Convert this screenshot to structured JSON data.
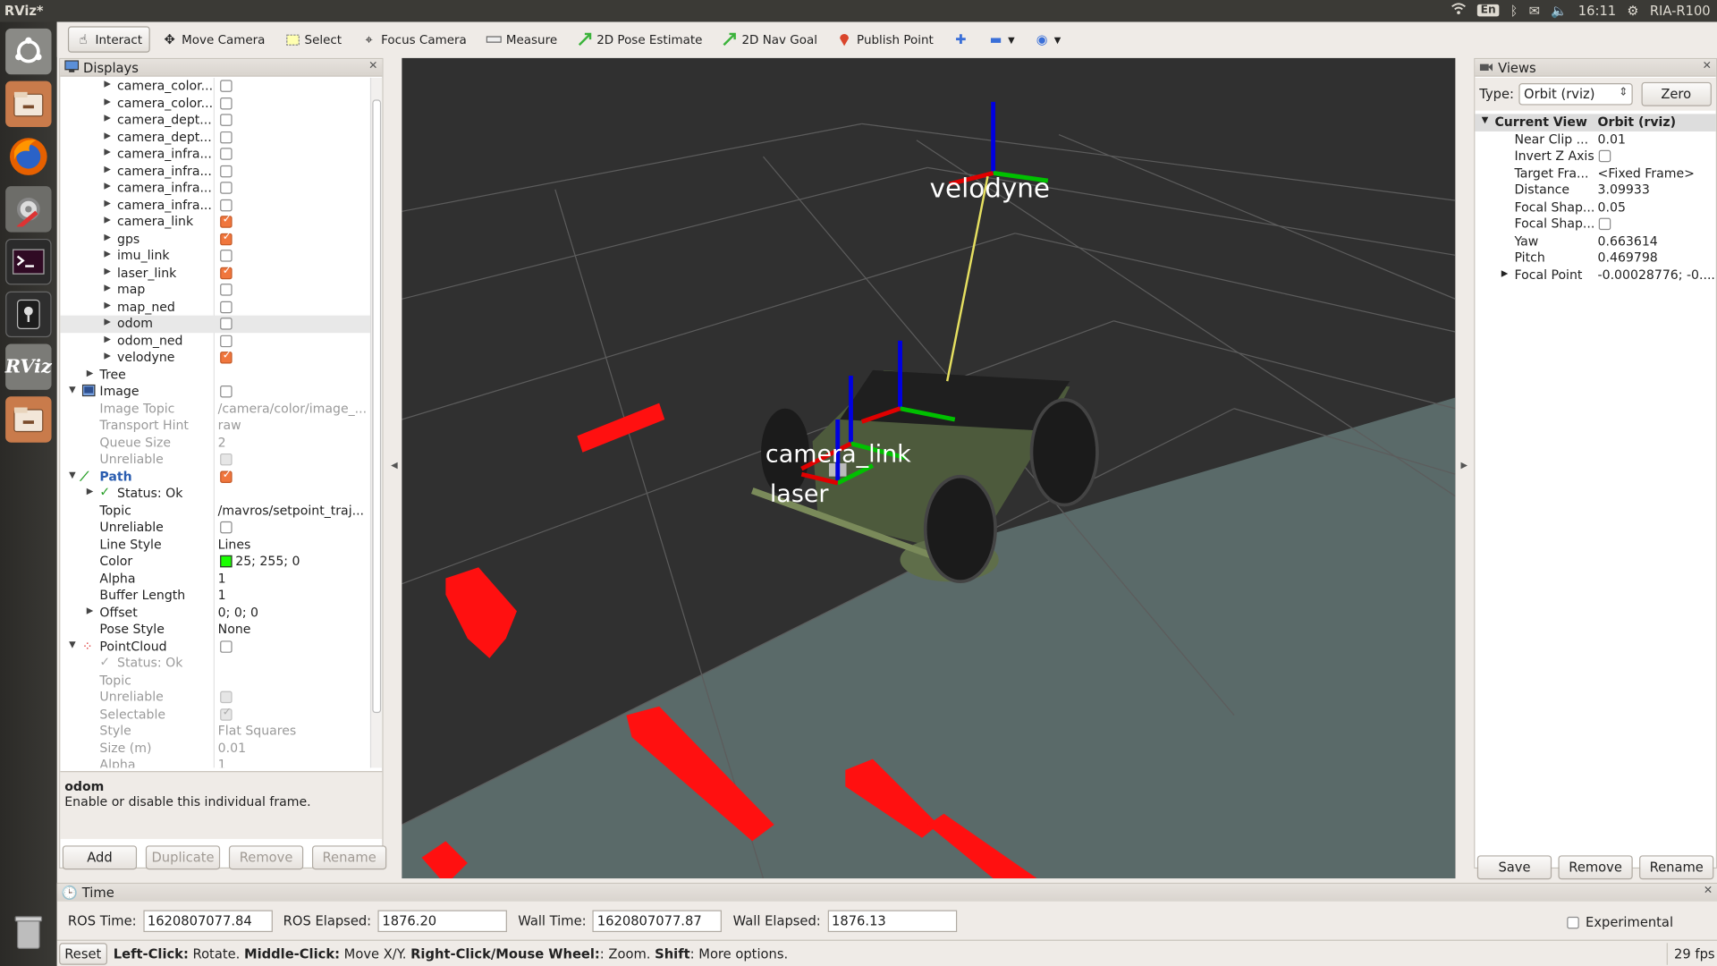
{
  "topbar": {
    "title": "RViz*",
    "lang": "En",
    "clock": "16:11",
    "host": "RIA-R100"
  },
  "toolbar": {
    "tools": [
      "Interact",
      "Move Camera",
      "Select",
      "Focus Camera",
      "Measure",
      "2D Pose Estimate",
      "2D Nav Goal",
      "Publish Point"
    ]
  },
  "displays": {
    "title": "Displays",
    "rows": [
      {
        "name": "camera_color...",
        "checked": false
      },
      {
        "name": "camera_color...",
        "checked": false
      },
      {
        "name": "camera_dept...",
        "checked": false
      },
      {
        "name": "camera_dept...",
        "checked": false
      },
      {
        "name": "camera_infra...",
        "checked": false
      },
      {
        "name": "camera_infra...",
        "checked": false
      },
      {
        "name": "camera_infra...",
        "checked": false
      },
      {
        "name": "camera_infra...",
        "checked": false
      },
      {
        "name": "camera_link",
        "checked": true
      },
      {
        "name": "gps",
        "checked": true
      },
      {
        "name": "imu_link",
        "checked": false
      },
      {
        "name": "laser_link",
        "checked": true
      },
      {
        "name": "map",
        "checked": false
      },
      {
        "name": "map_ned",
        "checked": false
      },
      {
        "name": "odom",
        "checked": false
      },
      {
        "name": "odom_ned",
        "checked": false
      },
      {
        "name": "velodyne",
        "checked": true
      }
    ],
    "tree_label": "Tree",
    "image": {
      "label": "Image",
      "props": [
        {
          "k": "Image Topic",
          "v": "/camera/color/image_..."
        },
        {
          "k": "Transport Hint",
          "v": "raw"
        },
        {
          "k": "Queue Size",
          "v": "2"
        },
        {
          "k": "Unreliable",
          "v": ""
        }
      ]
    },
    "path": {
      "label": "Path",
      "status": "Status: Ok",
      "props": [
        {
          "k": "Topic",
          "v": "/mavros/setpoint_traj..."
        },
        {
          "k": "Unreliable",
          "v": ""
        },
        {
          "k": "Line Style",
          "v": "Lines"
        },
        {
          "k": "Color",
          "v": "25; 255; 0"
        },
        {
          "k": "Alpha",
          "v": "1"
        },
        {
          "k": "Buffer Length",
          "v": "1"
        },
        {
          "k": "Offset",
          "v": "0; 0; 0"
        },
        {
          "k": "Pose Style",
          "v": "None"
        }
      ],
      "color_hex": "#19ff00"
    },
    "pointcloud": {
      "label": "PointCloud",
      "status": "Status: Ok",
      "props": [
        {
          "k": "Topic",
          "v": ""
        },
        {
          "k": "Unreliable",
          "v": ""
        },
        {
          "k": "Selectable",
          "v": ""
        },
        {
          "k": "Style",
          "v": "Flat Squares"
        },
        {
          "k": "Size (m)",
          "v": "0.01"
        },
        {
          "k": "Alpha",
          "v": "1"
        }
      ]
    },
    "desc_title": "odom",
    "desc_text": "Enable or disable this individual frame.",
    "buttons": {
      "add": "Add",
      "duplicate": "Duplicate",
      "remove": "Remove",
      "rename": "Rename"
    }
  },
  "viewport": {
    "labels": {
      "velodyne": "velodyne",
      "camera": "camera_link",
      "laser": "laser"
    }
  },
  "views": {
    "title": "Views",
    "type_label": "Type:",
    "type_value": "Orbit (rviz)",
    "zero": "Zero",
    "header_k": "Current View",
    "header_v": "Orbit (rviz)",
    "props": [
      {
        "k": "Near Clip ...",
        "v": "0.01"
      },
      {
        "k": "Invert Z Axis",
        "v": ""
      },
      {
        "k": "Target Fra...",
        "v": "<Fixed Frame>"
      },
      {
        "k": "Distance",
        "v": "3.09933"
      },
      {
        "k": "Focal Shap...",
        "v": "0.05"
      },
      {
        "k": "Focal Shap...",
        "v": ""
      },
      {
        "k": "Yaw",
        "v": "0.663614"
      },
      {
        "k": "Pitch",
        "v": "0.469798"
      },
      {
        "k": "Focal Point",
        "v": "-0.00028776; -0...."
      }
    ],
    "buttons": {
      "save": "Save",
      "remove": "Remove",
      "rename": "Rename"
    }
  },
  "time": {
    "title": "Time",
    "ros_time_label": "ROS Time:",
    "ros_time": "1620807077.84",
    "ros_elapsed_label": "ROS Elapsed:",
    "ros_elapsed": "1876.20",
    "wall_time_label": "Wall Time:",
    "wall_time": "1620807077.87",
    "wall_elapsed_label": "Wall Elapsed:",
    "wall_elapsed": "1876.13",
    "experimental": "Experimental"
  },
  "status": {
    "reset": "Reset",
    "lc": "Left-Click:",
    "lc_t": " Rotate. ",
    "mc": "Middle-Click:",
    "mc_t": " Move X/Y. ",
    "rc": "Right-Click/Mouse Wheel:",
    "rc_t": ": Zoom. ",
    "sh": "Shift",
    "sh_t": ": More options.",
    "fps": "29 fps"
  }
}
